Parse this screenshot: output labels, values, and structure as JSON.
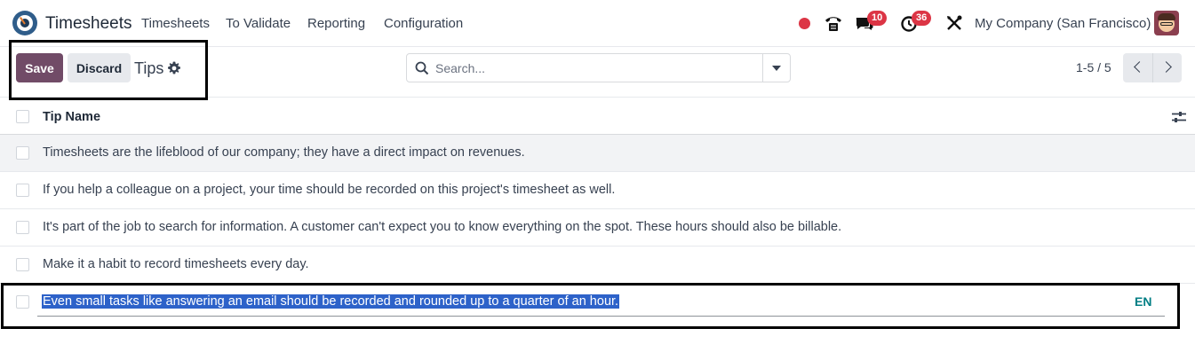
{
  "navbar": {
    "app_name": "Timesheets",
    "menu": [
      "Timesheets",
      "To Validate",
      "Reporting",
      "Configuration"
    ],
    "messages_count": "10",
    "activities_count": "36",
    "company": "My Company (San Francisco)"
  },
  "control_panel": {
    "save_label": "Save",
    "discard_label": "Discard",
    "breadcrumb": "Tips",
    "search_placeholder": "Search...",
    "pager": "1-5 / 5"
  },
  "list": {
    "column_title": "Tip Name",
    "rows": [
      "Timesheets are the lifeblood of our company; they have a direct impact on revenues.",
      "If you help a colleague on a project, your time should be recorded on this project's timesheet as well.",
      "It's part of the job to search for information. A customer can't expect you to know everything on the spot. These hours should also be billable.",
      "Make it a habit to record timesheets every day.",
      "Even small tasks like answering an email should be recorded and rounded up to a quarter of an hour."
    ],
    "lang_tag": "EN"
  },
  "colors": {
    "primary": "#714b67",
    "selection": "#2d62c9",
    "lang_tag": "#017e84",
    "badge": "#dc3545"
  }
}
